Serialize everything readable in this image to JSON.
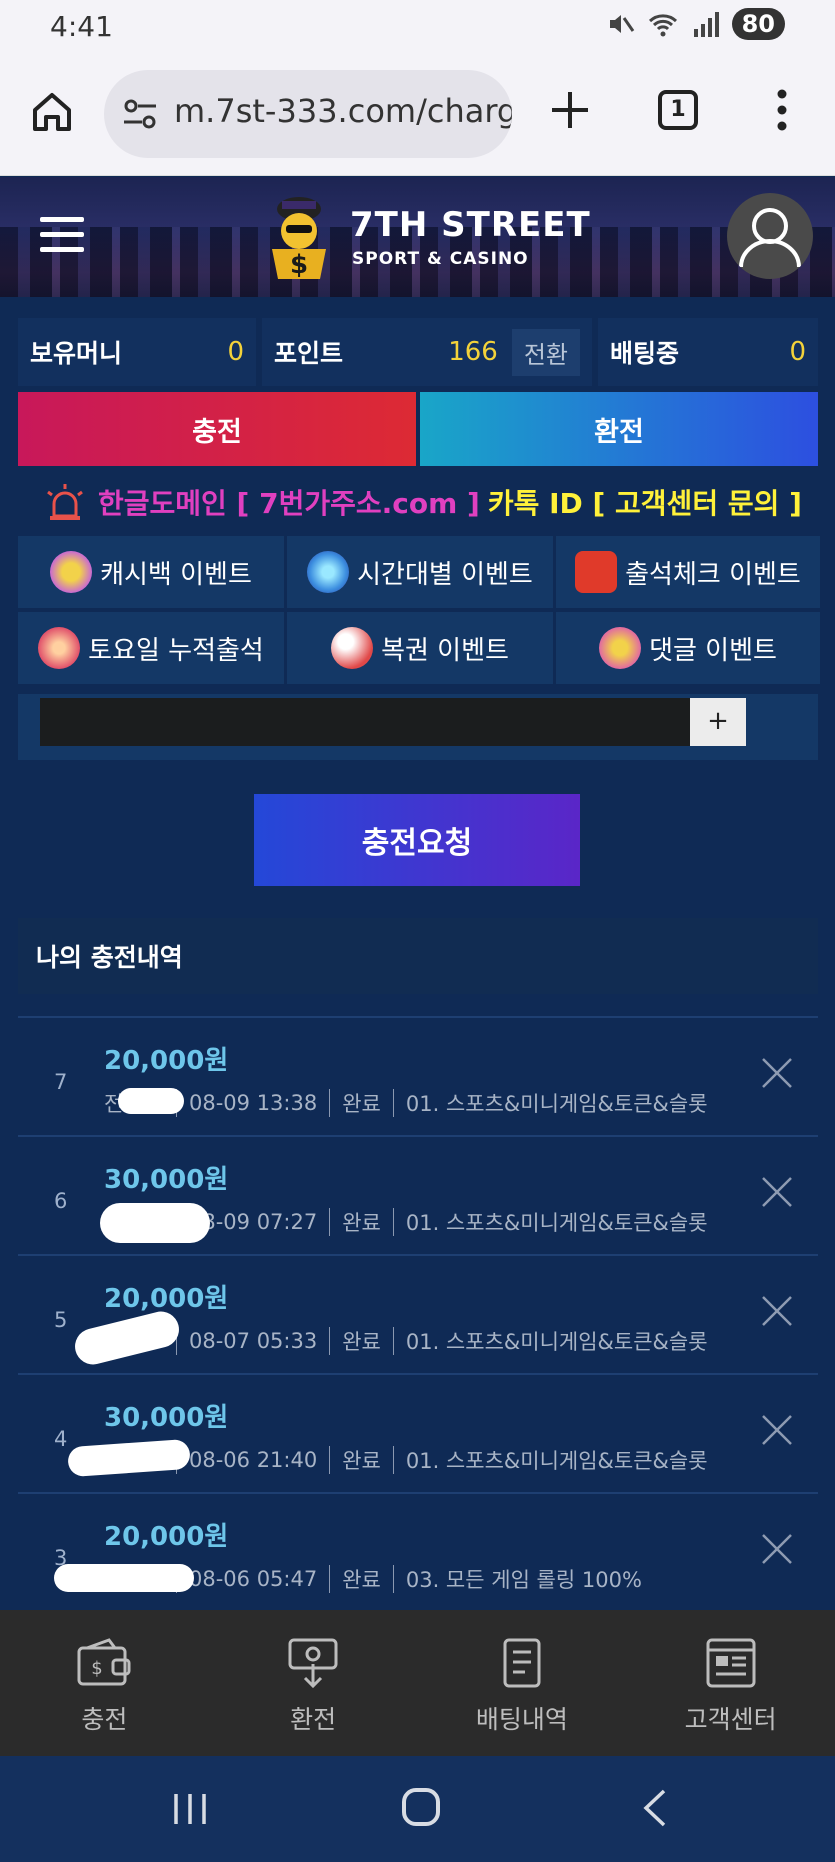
{
  "status_bar": {
    "time": "4:41",
    "battery": "80"
  },
  "browser": {
    "url": "m.7st-333.com/charg",
    "tab_count": "1"
  },
  "header": {
    "logo_title": "7TH STREET",
    "logo_subtitle": "SPORT & CASINO"
  },
  "wallet": {
    "money_label": "보유머니",
    "money_value": "0",
    "point_label": "포인트",
    "point_value": "166",
    "convert_label": "전환",
    "betting_label": "배팅중",
    "betting_value": "0"
  },
  "actions": {
    "charge_label": "충전",
    "exchange_label": "환전"
  },
  "notice": {
    "pink_text": "한글도메인 [ 7번가주소.com ]",
    "yellow_text": "카톡 ID [ 고객센터 문의 ]"
  },
  "events": [
    {
      "label": "캐시백 이벤트",
      "color": "#c96ad0"
    },
    {
      "label": "시간대별 이벤트",
      "color": "#3d8fe0"
    },
    {
      "label": "출석체크 이벤트",
      "color": "#e03a2a"
    },
    {
      "label": "토요일 누적출석",
      "color": "#e0506a"
    },
    {
      "label": "복권 이벤트",
      "color": "#e04848"
    },
    {
      "label": "댓글 이벤트",
      "color": "#e06aa0"
    }
  ],
  "input": {
    "plus_label": "+"
  },
  "request": {
    "label": "충전요청"
  },
  "history": {
    "title": "나의 충전내역",
    "items": [
      {
        "num": "7",
        "amount": "20,000원",
        "who": "전체",
        "datetime": "08-09 13:38",
        "status": "완료",
        "type": "01. 스포츠&미니게임&토큰&슬롯"
      },
      {
        "num": "6",
        "amount": "30,000원",
        "who": "",
        "datetime": "08-09 07:27",
        "status": "완료",
        "type": "01. 스포츠&미니게임&토큰&슬롯"
      },
      {
        "num": "5",
        "amount": "20,000원",
        "who": "",
        "datetime": "08-07 05:33",
        "status": "완료",
        "type": "01. 스포츠&미니게임&토큰&슬롯"
      },
      {
        "num": "4",
        "amount": "30,000원",
        "who": "",
        "datetime": "08-06 21:40",
        "status": "완료",
        "type": "01. 스포츠&미니게임&토큰&슬롯"
      },
      {
        "num": "3",
        "amount": "20,000원",
        "who": "",
        "datetime": "08-06 05:47",
        "status": "완료",
        "type": "03. 모든 게임 롤링 100%"
      }
    ]
  },
  "bottom_nav": [
    {
      "label": "충전",
      "icon": "wallet-icon"
    },
    {
      "label": "환전",
      "icon": "exchange-icon"
    },
    {
      "label": "배팅내역",
      "icon": "document-icon"
    },
    {
      "label": "고객센터",
      "icon": "newspaper-icon"
    }
  ]
}
